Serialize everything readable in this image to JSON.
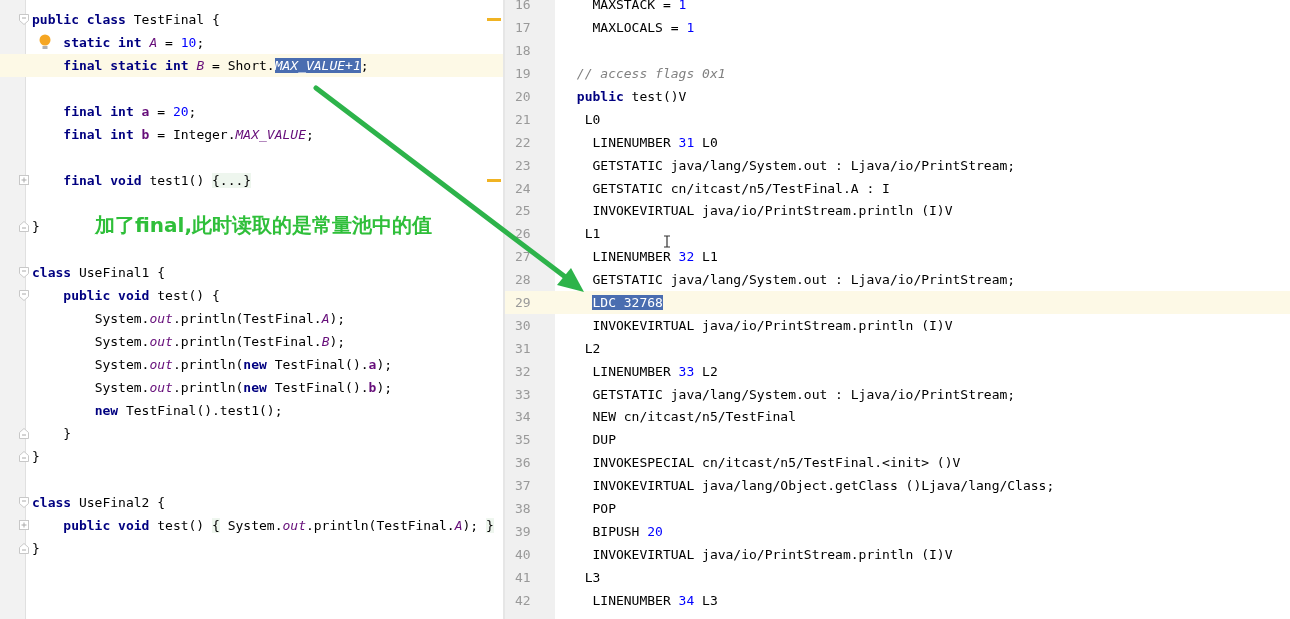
{
  "left_editor": {
    "lines": [
      {
        "gutter": [
          {
            "kind": "fold-open"
          }
        ],
        "highlighted": false,
        "stripe": true,
        "tokens": [
          {
            "kind": "kw",
            "text": "public class"
          },
          {
            "kind": "plain",
            "text": " TestFinal {"
          }
        ]
      },
      {
        "gutter": [
          {
            "kind": "bulb"
          }
        ],
        "highlighted": false,
        "tokens": [
          {
            "kind": "kw",
            "text": "    static int "
          },
          {
            "kind": "static",
            "text": "A"
          },
          {
            "kind": "plain",
            "text": " = "
          },
          {
            "kind": "num",
            "text": "10"
          },
          {
            "kind": "plain",
            "text": ";"
          }
        ]
      },
      {
        "highlighted": true,
        "tokens": [
          {
            "kind": "kw",
            "text": "    final static int "
          },
          {
            "kind": "static",
            "text": "B"
          },
          {
            "kind": "plain",
            "text": " = Short."
          },
          {
            "kind": "selected-static",
            "text": "MAX_VALUE+1"
          },
          {
            "kind": "plain",
            "text": ";"
          }
        ]
      },
      {
        "highlighted": false
      },
      {
        "highlighted": false,
        "tokens": [
          {
            "kind": "kw",
            "text": "    final int "
          },
          {
            "kind": "field",
            "text": "a"
          },
          {
            "kind": "plain",
            "text": " = "
          },
          {
            "kind": "num",
            "text": "20"
          },
          {
            "kind": "plain",
            "text": ";"
          }
        ]
      },
      {
        "highlighted": false,
        "tokens": [
          {
            "kind": "kw",
            "text": "    final int "
          },
          {
            "kind": "field",
            "text": "b"
          },
          {
            "kind": "plain",
            "text": " = Integer."
          },
          {
            "kind": "static",
            "text": "MAX_VALUE"
          },
          {
            "kind": "plain",
            "text": ";"
          }
        ]
      },
      {
        "highlighted": false
      },
      {
        "gutter": [
          {
            "kind": "fold-collapsed"
          }
        ],
        "highlighted": false,
        "stripe": true,
        "tokens": [
          {
            "kind": "kw",
            "text": "    final void"
          },
          {
            "kind": "plain",
            "text": " test1() "
          },
          {
            "kind": "folded",
            "text": "{...}"
          }
        ]
      },
      {
        "highlighted": false
      },
      {
        "gutter": [
          {
            "kind": "fold-close"
          }
        ],
        "highlighted": false,
        "tokens": [
          {
            "kind": "plain",
            "text": "}"
          }
        ]
      },
      {
        "highlighted": false
      },
      {
        "gutter": [
          {
            "kind": "fold-open"
          }
        ],
        "highlighted": false,
        "tokens": [
          {
            "kind": "kw",
            "text": "class"
          },
          {
            "kind": "plain",
            "text": " UseFinal1 {"
          }
        ]
      },
      {
        "gutter": [
          {
            "kind": "fold-open"
          }
        ],
        "highlighted": false,
        "tokens": [
          {
            "kind": "kw",
            "text": "    public void"
          },
          {
            "kind": "plain",
            "text": " test() {"
          }
        ]
      },
      {
        "highlighted": false,
        "tokens": [
          {
            "kind": "plain",
            "text": "        System."
          },
          {
            "kind": "static",
            "text": "out"
          },
          {
            "kind": "plain",
            "text": ".println(TestFinal."
          },
          {
            "kind": "static",
            "text": "A"
          },
          {
            "kind": "plain",
            "text": ");"
          }
        ]
      },
      {
        "highlighted": false,
        "tokens": [
          {
            "kind": "plain",
            "text": "        System."
          },
          {
            "kind": "static",
            "text": "out"
          },
          {
            "kind": "plain",
            "text": ".println(TestFinal."
          },
          {
            "kind": "static",
            "text": "B"
          },
          {
            "kind": "plain",
            "text": ");"
          }
        ]
      },
      {
        "highlighted": false,
        "tokens": [
          {
            "kind": "plain",
            "text": "        System."
          },
          {
            "kind": "static",
            "text": "out"
          },
          {
            "kind": "plain",
            "text": ".println("
          },
          {
            "kind": "kw",
            "text": "new"
          },
          {
            "kind": "plain",
            "text": " TestFinal()."
          },
          {
            "kind": "field",
            "text": "a"
          },
          {
            "kind": "plain",
            "text": ");"
          }
        ]
      },
      {
        "highlighted": false,
        "tokens": [
          {
            "kind": "plain",
            "text": "        System."
          },
          {
            "kind": "static",
            "text": "out"
          },
          {
            "kind": "plain",
            "text": ".println("
          },
          {
            "kind": "kw",
            "text": "new"
          },
          {
            "kind": "plain",
            "text": " TestFinal()."
          },
          {
            "kind": "field",
            "text": "b"
          },
          {
            "kind": "plain",
            "text": ");"
          }
        ]
      },
      {
        "highlighted": false,
        "tokens": [
          {
            "kind": "kw",
            "text": "        new"
          },
          {
            "kind": "plain",
            "text": " TestFinal().test1();"
          }
        ]
      },
      {
        "gutter": [
          {
            "kind": "fold-close"
          }
        ],
        "highlighted": false,
        "tokens": [
          {
            "kind": "plain",
            "text": "    }"
          }
        ]
      },
      {
        "gutter": [
          {
            "kind": "fold-close"
          }
        ],
        "highlighted": false,
        "tokens": [
          {
            "kind": "plain",
            "text": "}"
          }
        ]
      },
      {
        "highlighted": false
      },
      {
        "gutter": [
          {
            "kind": "fold-open"
          }
        ],
        "highlighted": false,
        "tokens": [
          {
            "kind": "kw",
            "text": "class"
          },
          {
            "kind": "plain",
            "text": " UseFinal2 {"
          }
        ]
      },
      {
        "gutter": [
          {
            "kind": "fold-collapsed"
          }
        ],
        "highlighted": false,
        "tokens": [
          {
            "kind": "kw",
            "text": "    public void"
          },
          {
            "kind": "plain",
            "text": " test() "
          },
          {
            "kind": "folded",
            "text": "{"
          },
          {
            "kind": "plain",
            "text": " System."
          },
          {
            "kind": "static",
            "text": "out"
          },
          {
            "kind": "plain",
            "text": ".println(TestFinal."
          },
          {
            "kind": "static",
            "text": "A"
          },
          {
            "kind": "plain",
            "text": "); "
          },
          {
            "kind": "folded",
            "text": "}"
          }
        ]
      },
      {
        "gutter": [
          {
            "kind": "fold-close"
          }
        ],
        "highlighted": false,
        "tokens": [
          {
            "kind": "plain",
            "text": "}"
          }
        ]
      }
    ],
    "annotation": "加了final,此时读取的是常量池中的值"
  },
  "right_editor": {
    "lines": [
      {
        "number": "16",
        "highlighted": false,
        "tokens": [
          {
            "kind": "plain",
            "text": "   MAXSTACK = "
          },
          {
            "kind": "num",
            "text": "1"
          }
        ]
      },
      {
        "number": "17",
        "highlighted": false,
        "tokens": [
          {
            "kind": "plain",
            "text": "   MAXLOCALS = "
          },
          {
            "kind": "num",
            "text": "1"
          }
        ]
      },
      {
        "number": "18",
        "highlighted": false
      },
      {
        "number": "19",
        "highlighted": false,
        "tokens": [
          {
            "kind": "comment",
            "text": " // access flags 0x1"
          }
        ]
      },
      {
        "number": "20",
        "highlighted": false,
        "tokens": [
          {
            "kind": "kw",
            "text": " public"
          },
          {
            "kind": "plain",
            "text": " test()V"
          }
        ]
      },
      {
        "number": "21",
        "highlighted": false,
        "tokens": [
          {
            "kind": "plain",
            "text": "  L0"
          }
        ]
      },
      {
        "number": "22",
        "highlighted": false,
        "tokens": [
          {
            "kind": "plain",
            "text": "   LINENUMBER "
          },
          {
            "kind": "num",
            "text": "31"
          },
          {
            "kind": "plain",
            "text": " L0"
          }
        ]
      },
      {
        "number": "23",
        "highlighted": false,
        "tokens": [
          {
            "kind": "plain",
            "text": "   GETSTATIC java/lang/System.out : Ljava/io/PrintStream;"
          }
        ]
      },
      {
        "number": "24",
        "highlighted": false,
        "tokens": [
          {
            "kind": "plain",
            "text": "   GETSTATIC cn/itcast/n5/TestFinal.A : I"
          }
        ]
      },
      {
        "number": "25",
        "highlighted": false,
        "tokens": [
          {
            "kind": "plain",
            "text": "   INVOKEVIRTUAL java/io/PrintStream.println (I)V"
          }
        ]
      },
      {
        "number": "26",
        "highlighted": false,
        "tokens": [
          {
            "kind": "plain",
            "text": "  L1"
          }
        ]
      },
      {
        "number": "27",
        "highlighted": false,
        "tokens": [
          {
            "kind": "plain",
            "text": "   LINENUMBER "
          },
          {
            "kind": "num",
            "text": "32"
          },
          {
            "kind": "plain",
            "text": " L1"
          }
        ]
      },
      {
        "number": "28",
        "highlighted": false,
        "tokens": [
          {
            "kind": "plain",
            "text": "   GETSTATIC java/lang/System.out : Ljava/io/PrintStream;"
          }
        ]
      },
      {
        "number": "29",
        "highlighted": true,
        "tokens": [
          {
            "kind": "selected",
            "text": "   LDC 32768"
          }
        ]
      },
      {
        "number": "30",
        "highlighted": false,
        "tokens": [
          {
            "kind": "plain",
            "text": "   INVOKEVIRTUAL java/io/PrintStream.println (I)V"
          }
        ]
      },
      {
        "number": "31",
        "highlighted": false,
        "tokens": [
          {
            "kind": "plain",
            "text": "  L2"
          }
        ]
      },
      {
        "number": "32",
        "highlighted": false,
        "tokens": [
          {
            "kind": "plain",
            "text": "   LINENUMBER "
          },
          {
            "kind": "num",
            "text": "33"
          },
          {
            "kind": "plain",
            "text": " L2"
          }
        ]
      },
      {
        "number": "33",
        "highlighted": false,
        "tokens": [
          {
            "kind": "plain",
            "text": "   GETSTATIC java/lang/System.out : Ljava/io/PrintStream;"
          }
        ]
      },
      {
        "number": "34",
        "highlighted": false,
        "tokens": [
          {
            "kind": "plain",
            "text": "   NEW cn/itcast/n5/TestFinal"
          }
        ]
      },
      {
        "number": "35",
        "highlighted": false,
        "tokens": [
          {
            "kind": "plain",
            "text": "   DUP"
          }
        ]
      },
      {
        "number": "36",
        "highlighted": false,
        "tokens": [
          {
            "kind": "plain",
            "text": "   INVOKESPECIAL cn/itcast/n5/TestFinal.<init> ()V"
          }
        ]
      },
      {
        "number": "37",
        "highlighted": false,
        "tokens": [
          {
            "kind": "plain",
            "text": "   INVOKEVIRTUAL java/lang/Object.getClass ()Ljava/lang/Class;"
          }
        ]
      },
      {
        "number": "38",
        "highlighted": false,
        "tokens": [
          {
            "kind": "plain",
            "text": "   POP"
          }
        ]
      },
      {
        "number": "39",
        "highlighted": false,
        "tokens": [
          {
            "kind": "plain",
            "text": "   BIPUSH "
          },
          {
            "kind": "num",
            "text": "20"
          }
        ]
      },
      {
        "number": "40",
        "highlighted": false,
        "tokens": [
          {
            "kind": "plain",
            "text": "   INVOKEVIRTUAL java/io/PrintStream.println (I)V"
          }
        ]
      },
      {
        "number": "41",
        "highlighted": false,
        "tokens": [
          {
            "kind": "plain",
            "text": "  L3"
          }
        ]
      },
      {
        "number": "42",
        "highlighted": false,
        "tokens": [
          {
            "kind": "plain",
            "text": "   LINENUMBER "
          },
          {
            "kind": "num",
            "text": "34"
          },
          {
            "kind": "plain",
            "text": " L3"
          }
        ]
      }
    ]
  }
}
